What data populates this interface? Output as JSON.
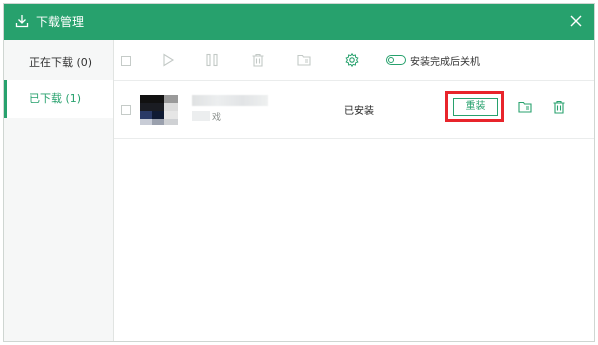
{
  "window": {
    "title": "下载管理"
  },
  "sidebar": {
    "items": [
      {
        "label": "正在下载 (0)"
      },
      {
        "label": "已下载 (1)"
      }
    ]
  },
  "toolbar": {
    "toggle_label": "安装完成后关机",
    "icons": [
      "select-all-checkbox",
      "play-icon",
      "pause-icon",
      "trash-icon",
      "folder-icon",
      "gear-icon",
      "toggle-switch"
    ]
  },
  "downloads": [
    {
      "name_partial": "戏",
      "status": "已安装",
      "action_label": "重装"
    }
  ],
  "colors": {
    "accent": "#27a16d",
    "highlight": "#e8242b"
  }
}
